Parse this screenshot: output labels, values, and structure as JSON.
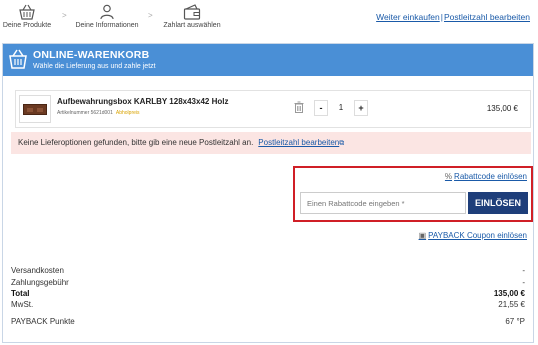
{
  "steps": [
    {
      "label": "Deine Produkte",
      "icon": "basket-icon"
    },
    {
      "label": "Deine Informationen",
      "icon": "person-icon"
    },
    {
      "label": "Zahlart auswählen",
      "icon": "wallet-icon"
    }
  ],
  "step_separator": ">",
  "top_links": {
    "continue": "Weiter einkaufen",
    "separator": "|",
    "postcode": "Postleitzahl bearbeiten"
  },
  "cart": {
    "title": "ONLINE-WARENKORB",
    "subtitle": "Wähle die Lieferung aus und zahle jetzt"
  },
  "product": {
    "name": "Aufbewahrungsbox KARLBY 128x43x42 Holz",
    "article": "Artikelnummer 5621d001",
    "tag": "Abholpreis",
    "qty_minus": "-",
    "qty": "1",
    "qty_plus": "+",
    "price": "135,00 €"
  },
  "warning": {
    "text": "Keine Lieferoptionen gefunden, bitte gib eine neue Postleitzahl an.",
    "link": "Postleitzahl bearbeiten"
  },
  "coupon": {
    "link": "Rabattcode einlösen",
    "placeholder": "Einen Rabattcode eingeben *",
    "button": "EINLÖSEN"
  },
  "payback_link": "PAYBACK Coupon einlösen",
  "summary": [
    {
      "label": "Versandkosten",
      "value": "-"
    },
    {
      "label": "Zahlungsgebühr",
      "value": "-"
    },
    {
      "label": "Total",
      "value": "135,00 €"
    },
    {
      "label": "MwSt.",
      "value": "21,55 €"
    },
    {
      "label": "PAYBACK Punkte",
      "value": "67 °P"
    }
  ],
  "colors": {
    "header_blue": "#4a8fd6",
    "link_blue": "#1a5aa8",
    "button_navy": "#1e3e7a",
    "highlight_red": "#d01f26",
    "warning_bg": "#fbe5e3"
  }
}
